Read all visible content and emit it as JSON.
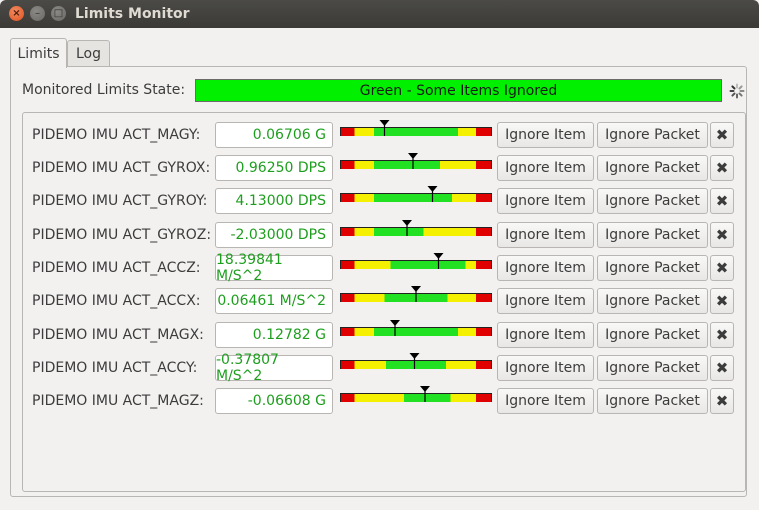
{
  "window": {
    "title": "Limits Monitor",
    "controls": {
      "close": "×",
      "minimize": "–",
      "maximize": "□"
    }
  },
  "tabs": [
    {
      "label": "Limits",
      "active": true
    },
    {
      "label": "Log",
      "active": false
    }
  ],
  "state": {
    "label": "Monitored Limits State:",
    "value": "Green - Some Items Ignored",
    "color": "#00f000"
  },
  "buttons": {
    "ignore_item": "Ignore Item",
    "ignore_packet": "Ignore Packet",
    "remove": "✖"
  },
  "colors": {
    "red": "#e00000",
    "yellow": "#f4f000",
    "green": "#22e022",
    "value_text": "#1e9e1e"
  },
  "items": [
    {
      "name": "PIDEMO IMU ACT_MAGY:",
      "value": "0.06706 G",
      "bands": [
        {
          "c": "red",
          "w": 0.09
        },
        {
          "c": "yellow",
          "w": 0.13
        },
        {
          "c": "green",
          "w": 0.56
        },
        {
          "c": "yellow",
          "w": 0.12
        },
        {
          "c": "red",
          "w": 0.1
        }
      ],
      "marker": 0.29
    },
    {
      "name": "PIDEMO IMU ACT_GYROX:",
      "value": "0.96250 DPS",
      "bands": [
        {
          "c": "red",
          "w": 0.09
        },
        {
          "c": "yellow",
          "w": 0.13
        },
        {
          "c": "green",
          "w": 0.44
        },
        {
          "c": "yellow",
          "w": 0.24
        },
        {
          "c": "red",
          "w": 0.1
        }
      ],
      "marker": 0.48
    },
    {
      "name": "PIDEMO IMU ACT_GYROY:",
      "value": "4.13000 DPS",
      "bands": [
        {
          "c": "red",
          "w": 0.09
        },
        {
          "c": "yellow",
          "w": 0.13
        },
        {
          "c": "green",
          "w": 0.52
        },
        {
          "c": "yellow",
          "w": 0.16
        },
        {
          "c": "red",
          "w": 0.1
        }
      ],
      "marker": 0.61
    },
    {
      "name": "PIDEMO IMU ACT_GYROZ:",
      "value": "-2.03000 DPS",
      "bands": [
        {
          "c": "red",
          "w": 0.09
        },
        {
          "c": "yellow",
          "w": 0.13
        },
        {
          "c": "green",
          "w": 0.33
        },
        {
          "c": "yellow",
          "w": 0.35
        },
        {
          "c": "red",
          "w": 0.1
        }
      ],
      "marker": 0.44
    },
    {
      "name": "PIDEMO IMU ACT_ACCZ:",
      "value": "18.39841 M/S^2",
      "bands": [
        {
          "c": "red",
          "w": 0.09
        },
        {
          "c": "yellow",
          "w": 0.24
        },
        {
          "c": "green",
          "w": 0.5
        },
        {
          "c": "yellow",
          "w": 0.07
        },
        {
          "c": "red",
          "w": 0.1
        }
      ],
      "marker": 0.65
    },
    {
      "name": "PIDEMO IMU ACT_ACCX:",
      "value": "0.06461 M/S^2",
      "bands": [
        {
          "c": "red",
          "w": 0.09
        },
        {
          "c": "yellow",
          "w": 0.2
        },
        {
          "c": "green",
          "w": 0.42
        },
        {
          "c": "yellow",
          "w": 0.19
        },
        {
          "c": "red",
          "w": 0.1
        }
      ],
      "marker": 0.5
    },
    {
      "name": "PIDEMO IMU ACT_MAGX:",
      "value": "0.12782 G",
      "bands": [
        {
          "c": "red",
          "w": 0.09
        },
        {
          "c": "yellow",
          "w": 0.13
        },
        {
          "c": "green",
          "w": 0.56
        },
        {
          "c": "yellow",
          "w": 0.12
        },
        {
          "c": "red",
          "w": 0.1
        }
      ],
      "marker": 0.36
    },
    {
      "name": "PIDEMO IMU ACT_ACCY:",
      "value": "-0.37807 M/S^2",
      "bands": [
        {
          "c": "red",
          "w": 0.09
        },
        {
          "c": "yellow",
          "w": 0.21
        },
        {
          "c": "green",
          "w": 0.4
        },
        {
          "c": "yellow",
          "w": 0.2
        },
        {
          "c": "red",
          "w": 0.1
        }
      ],
      "marker": 0.49
    },
    {
      "name": "PIDEMO IMU ACT_MAGZ:",
      "value": "-0.06608 G",
      "bands": [
        {
          "c": "red",
          "w": 0.09
        },
        {
          "c": "yellow",
          "w": 0.33
        },
        {
          "c": "green",
          "w": 0.31
        },
        {
          "c": "yellow",
          "w": 0.17
        },
        {
          "c": "red",
          "w": 0.1
        }
      ],
      "marker": 0.56
    }
  ]
}
